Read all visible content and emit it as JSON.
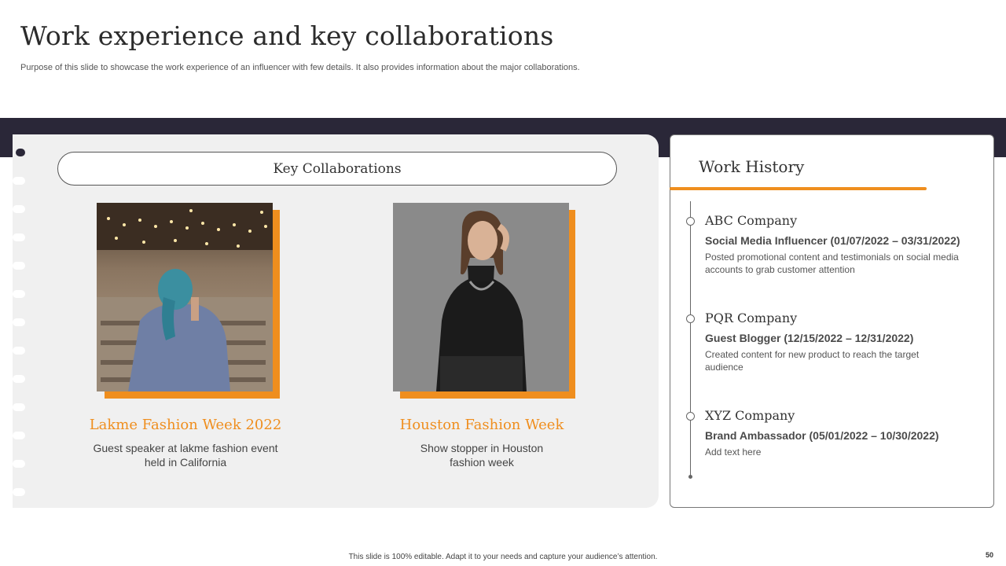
{
  "header": {
    "title": "Work experience and key collaborations",
    "subtitle": "Purpose of this slide to showcase the work experience of an influencer with few details. It also provides information about the major collaborations."
  },
  "collaborations": {
    "heading": "Key Collaborations",
    "items": [
      {
        "title": "Lakme Fashion Week 2022",
        "description": "Guest speaker at lakme fashion event held in California"
      },
      {
        "title": "Houston Fashion Week",
        "description": "Show stopper in Houston fashion week"
      }
    ]
  },
  "work_history": {
    "heading": "Work History",
    "entries": [
      {
        "company": "ABC Company",
        "role": "Social Media Influencer (01/07/2022 – 03/31/2022)",
        "detail": "Posted promotional content and testimonials on social media accounts to grab customer attention"
      },
      {
        "company": "PQR Company",
        "role": "Guest Blogger (12/15/2022 – 12/31/2022)",
        "detail": "Created content for new product to reach the target audience"
      },
      {
        "company": "XYZ Company",
        "role": "Brand Ambassador (05/01/2022 – 10/30/2022)",
        "detail": "Add text here"
      }
    ]
  },
  "footer": {
    "note": "This slide is 100% editable. Adapt it to your needs and capture your audience’s attention.",
    "page_number": "50"
  },
  "colors": {
    "accent": "#ef8e1e",
    "band": "#2a2738",
    "panel": "#f0f0f0"
  }
}
